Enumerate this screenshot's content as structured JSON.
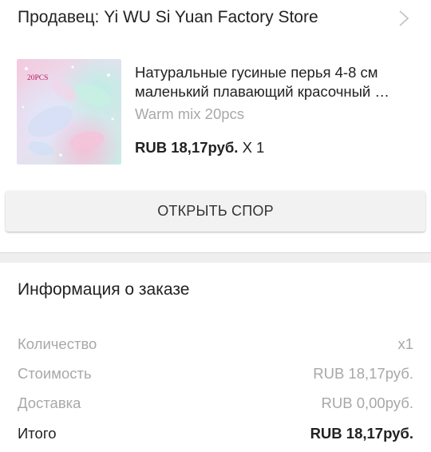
{
  "seller": {
    "label": "Продавец: Yi WU Si Yuan Factory Store"
  },
  "product": {
    "thumb_badge": "20PCS",
    "title": "Натуральные гусиные перья 4-8 см маленький плавающий красочный …",
    "variant": "Warm mix 20pcs",
    "price": "RUB 18,17руб.",
    "quantity": "X 1"
  },
  "dispute": {
    "button_label": "ОТКРЫТЬ СПОР"
  },
  "order_info": {
    "title": "Информация о заказе",
    "rows": [
      {
        "label": "Количество",
        "value": "x1"
      },
      {
        "label": "Стоимость",
        "value": "RUB 18,17руб."
      },
      {
        "label": "Доставка",
        "value": "RUB 0,00руб."
      },
      {
        "label": "Итого",
        "value": "RUB 18,17руб."
      }
    ]
  },
  "colors": {
    "text_primary": "#222222",
    "text_secondary": "#a8a8a8",
    "button_bg": "#f2f2f2",
    "divider_bg": "#efefef"
  }
}
